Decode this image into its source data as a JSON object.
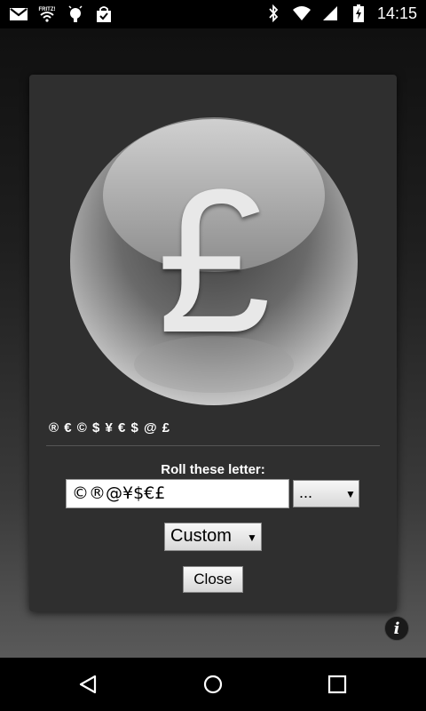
{
  "status_bar": {
    "time": "14:15",
    "left_icons": [
      "gmail-icon",
      "wifi-hotspot-icon",
      "android-debug-icon",
      "shopping-bag-icon"
    ],
    "right_icons": [
      "bluetooth-icon",
      "wifi-signal-icon",
      "cell-signal-icon",
      "battery-charging-icon"
    ]
  },
  "dialog": {
    "coin_symbol": "£",
    "sequence_text": "® € © $ ¥ € $ @ £",
    "roll_label": "Roll these letter:",
    "letters_value": "©®@¥$€£",
    "preset_select_value": "...",
    "mode_select_value": "Custom",
    "close_label": "Close"
  },
  "info_button_label": "i",
  "nav_bar": {
    "icons": [
      "back-icon",
      "home-icon",
      "recents-icon"
    ]
  },
  "colors": {
    "dialog_bg": "#2f2f2f",
    "coin_symbol": "#e8e8e8"
  }
}
